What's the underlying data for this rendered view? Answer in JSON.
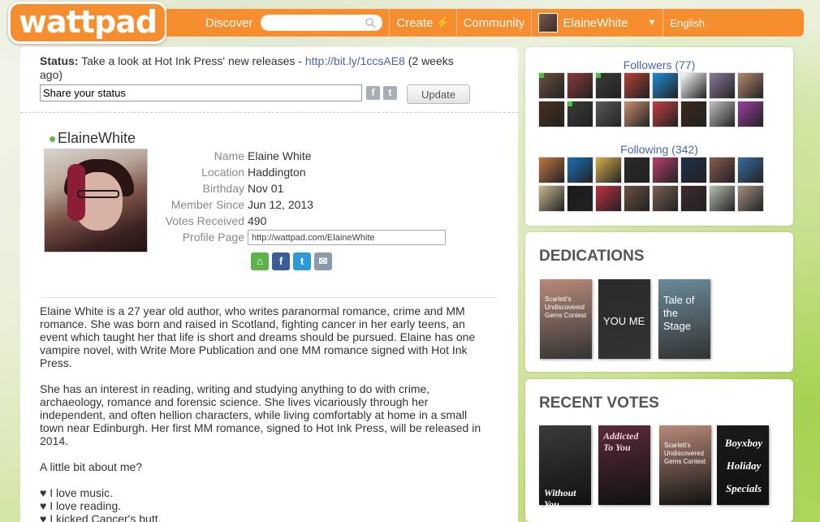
{
  "brand": {
    "logo": "wattpad",
    "accent": "#f68d2e"
  },
  "nav": {
    "discover": "Discover",
    "search_placeholder": "",
    "create": "Create",
    "community": "Community",
    "username": "ElaineWhite",
    "language": "English"
  },
  "status": {
    "label": "Status:",
    "text": "Take a look at Hot Ink Press' new releases -",
    "link": "http://bit.ly/1ccsAE8",
    "ago": "(2 weeks ago)",
    "input_value": "Share your status",
    "update": "Update"
  },
  "profile": {
    "name": "ElaineWhite",
    "fields": [
      {
        "label": "Name",
        "value": "Elaine White"
      },
      {
        "label": "Location",
        "value": "Haddington"
      },
      {
        "label": "Birthday",
        "value": "Nov 01"
      },
      {
        "label": "Member Since",
        "value": "Jun 12, 2013"
      },
      {
        "label": "Votes Received",
        "value": "490"
      }
    ],
    "page_label": "Profile Page",
    "page_url": "http://wattpad.com/ElaineWhite"
  },
  "bio": {
    "p1": "Elaine White is a 27 year old author, who writes paranormal romance, crime and MM romance. She was born and raised in Scotland, fighting cancer in her early teens, an event which taught her that life is short and dreams should be pursued. Elaine has one vampire novel, with Write More Publication and one MM romance signed with Hot Ink Press.",
    "p2": "She has an interest in reading, writing and studying anything to do with crime, archaeology, romance and forensic science. She lives vicariously through her independent, and often hellion characters, while living comfortably at home in a small town near Edinburgh. Her first MM romance, signed to Hot Ink Press, will be released in 2014.",
    "p3": "A little bit about me?",
    "list": [
      "♥ I love music.",
      "♥ I love reading.",
      "♥ I kicked Cancer's butt."
    ]
  },
  "followers": {
    "title": "Followers (77)"
  },
  "following": {
    "title": "Following (342)"
  },
  "follower_thumb_colors": [
    "#6b5040",
    "#8c3a3a",
    "#3b3b3b",
    "#b04030",
    "#1f8ad6",
    "#ffffff",
    "#8a7a9a",
    "#b48a70",
    "#4a3020",
    "#3a3a3a",
    "#5a5a5a",
    "#c89070",
    "#c04040",
    "#3a2a1a",
    "#c0c0c0",
    "#9a3fa0"
  ],
  "following_thumb_colors": [
    "#c07840",
    "#1b6fb8",
    "#d8b050",
    "#2a2a2a",
    "#b84070",
    "#20304a",
    "#8a5a50",
    "#3a6aa0",
    "#c8b890",
    "#1a1a1a",
    "#c03040",
    "#6a5040",
    "#7a6050",
    "#3a2a2a",
    "#b8c0b0",
    "#a09080"
  ],
  "dedications": {
    "title": "DEDICATIONS",
    "covers": [
      {
        "text": "Scarlett's Undiscovered Gems Contest",
        "color": "#b88a7a"
      },
      {
        "text": "YOU ME",
        "color": "#2a2a2a"
      },
      {
        "text": "Tale of the Stage",
        "color": "#6a8a9a"
      }
    ]
  },
  "recent_votes": {
    "title": "RECENT VOTES",
    "covers": [
      {
        "text": "Without You",
        "color": "#3a3a3a"
      },
      {
        "text": "Addicted To You",
        "color": "#5a2a3a"
      },
      {
        "text": "Scarlett's Undiscovered Gems Contest",
        "color": "#b88a7a"
      },
      {
        "text": "Boyxboy Holiday Specials",
        "color": "#1a1a1a"
      }
    ]
  }
}
